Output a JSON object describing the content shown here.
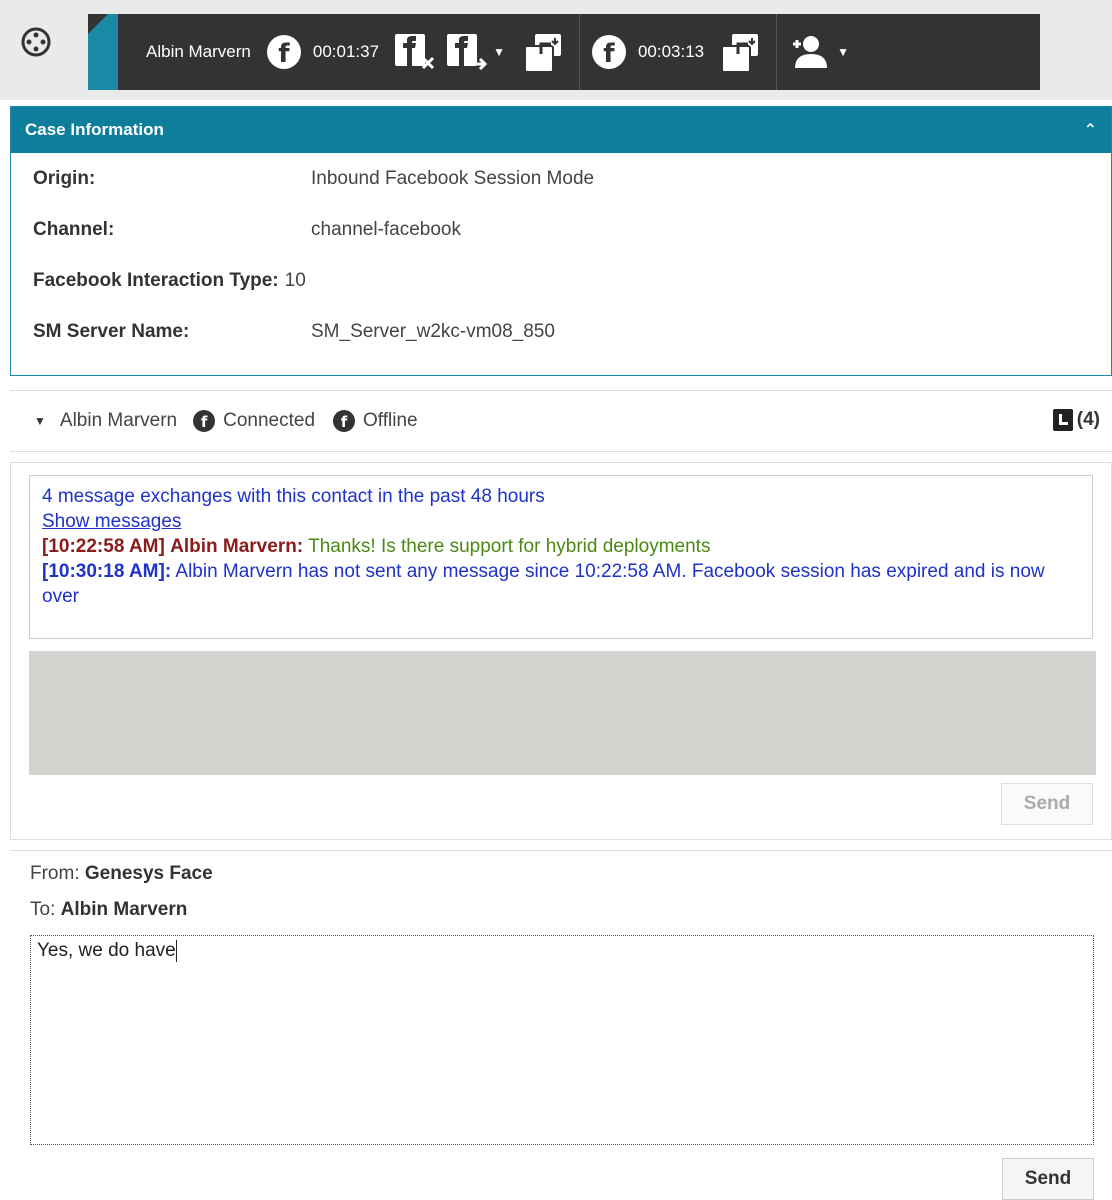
{
  "toolbar": {
    "contact_name": "Albin Marvern",
    "timer_1": "00:01:37",
    "timer_2": "00:03:13",
    "icons": [
      "app-menu-icon",
      "facebook-icon",
      "facebook-end-icon",
      "facebook-transfer-icon",
      "consult-icon",
      "facebook-icon",
      "consult-icon",
      "party-action-icon"
    ]
  },
  "case_info": {
    "title": "Case Information",
    "rows": [
      {
        "label": "Origin:",
        "value": "Inbound Facebook Session Mode"
      },
      {
        "label": "Channel:",
        "value": "channel-facebook"
      },
      {
        "label": "Facebook Interaction Type:",
        "value": "10"
      },
      {
        "label": "SM Server Name:",
        "value": "SM_Server_w2kc-vm08_850"
      }
    ]
  },
  "contact_bar": {
    "name": "Albin Marvern",
    "status_1": "Connected",
    "status_2": "Offline",
    "history_count": "(4)"
  },
  "transcript": {
    "history_notice": "4 message exchanges with this contact in the past 48 hours",
    "show_messages": "Show messages",
    "msg1_time": "[10:22:58 AM]",
    "msg1_sender": "Albin Marvern:",
    "msg1_text": "Thanks! Is there support for hybrid deployments",
    "msg2_time": "[10:30:18 AM]",
    "msg2_sender": ":",
    "msg2_text": "Albin Marvern has not sent any message since 10:22:58 AM. Facebook session has expired and is now over",
    "send_label": "Send"
  },
  "compose": {
    "from_label": "From:",
    "from_value": "Genesys Face",
    "to_label": "To:",
    "to_value": "Albin Marvern",
    "text": "Yes, we do have",
    "send_label": "Send"
  },
  "colors": {
    "toolbar_bg": "#333333",
    "accent": "#0e7e9c",
    "link_blue": "#1f32c9",
    "sender_red": "#8c1b1b",
    "message_green": "#4a8a13"
  }
}
